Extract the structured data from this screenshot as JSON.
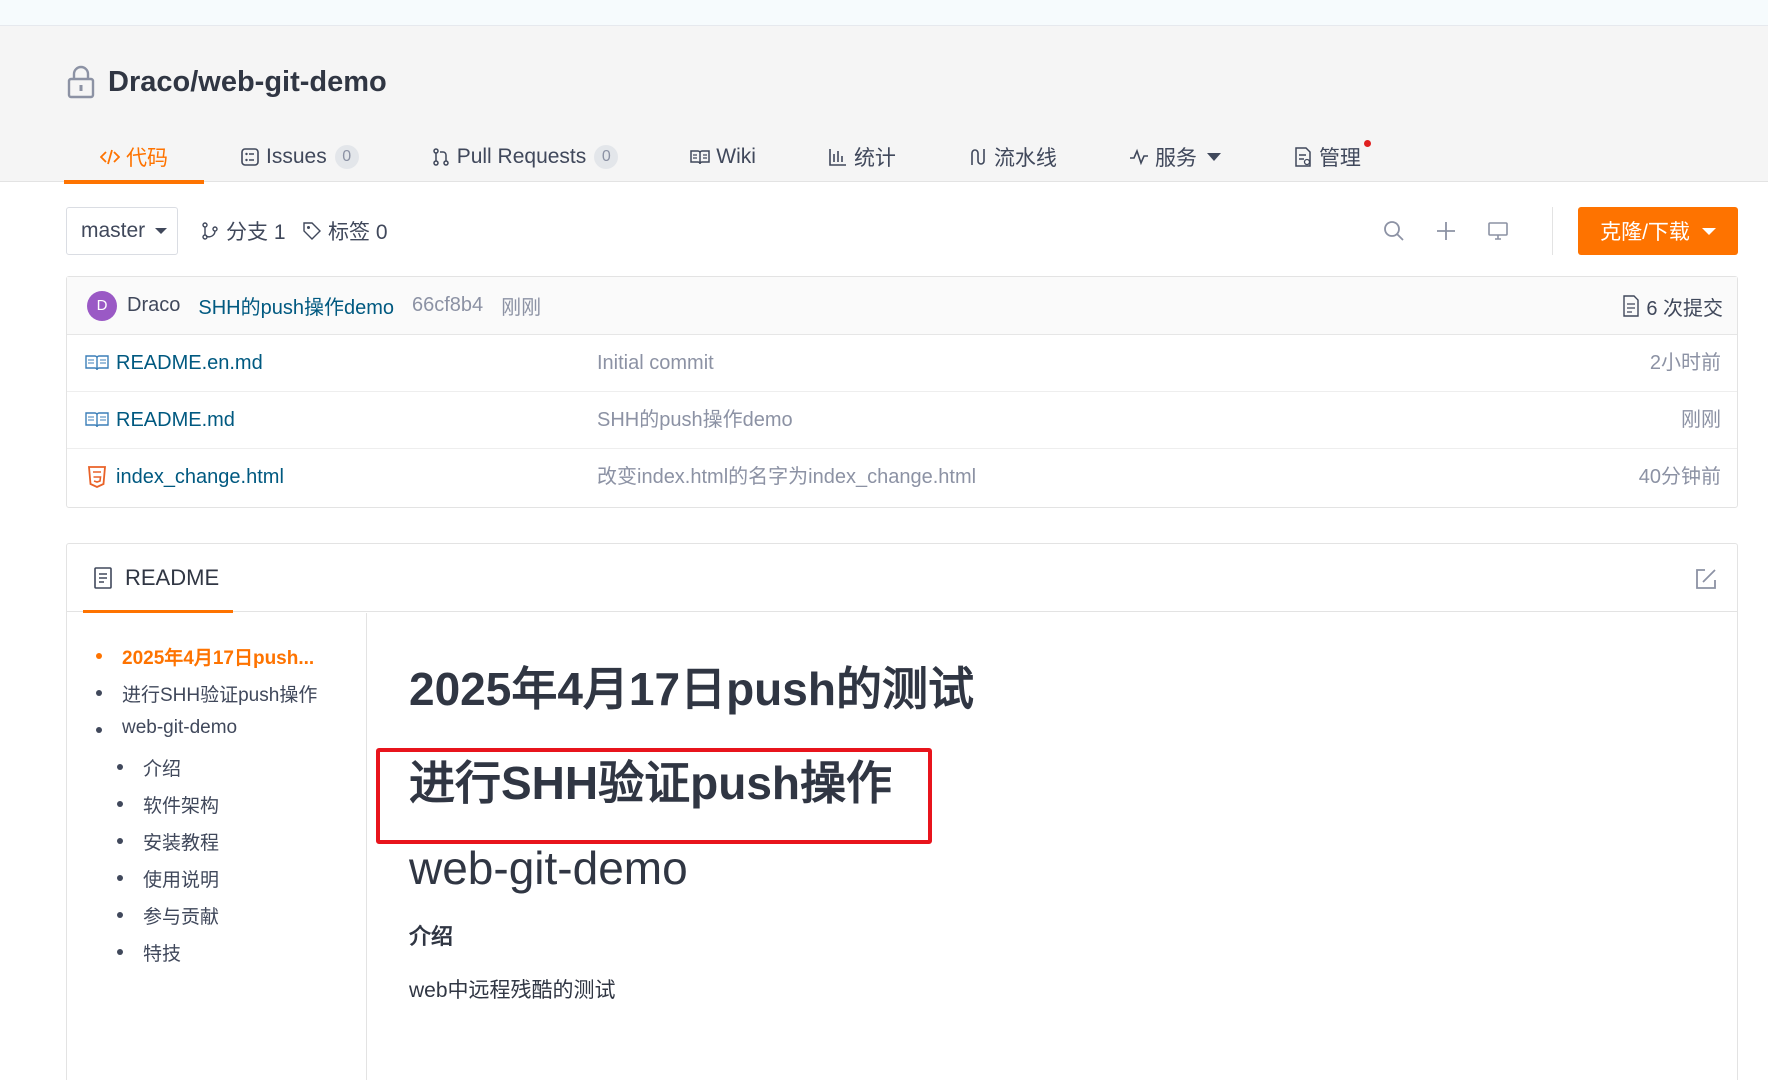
{
  "repo": {
    "full_name": "Draco/web-git-demo"
  },
  "tabs": [
    {
      "label": "代码",
      "icon": "code-icon",
      "active": true
    },
    {
      "label": "Issues",
      "count": "0",
      "icon": "issues-icon"
    },
    {
      "label": "Pull Requests",
      "count": "0",
      "icon": "pull-request-icon"
    },
    {
      "label": "Wiki",
      "icon": "wiki-book-icon"
    },
    {
      "label": "统计",
      "icon": "stats-chart-icon"
    },
    {
      "label": "流水线",
      "icon": "pipeline-icon"
    },
    {
      "label": "服务",
      "icon": "service-pulse-icon",
      "dropdown": true
    },
    {
      "label": "管理",
      "icon": "manage-doc-icon",
      "has_notification": true
    }
  ],
  "toolbar": {
    "branch": "master",
    "branches_label": "分支 1",
    "tags_label": "标签 0",
    "clone_label": "克隆/下载"
  },
  "latest_commit": {
    "avatar_letter": "D",
    "author": "Draco",
    "message": "SHH的push操作demo",
    "sha": "66cf8b4",
    "time": "刚刚",
    "commits_label": "6 次提交"
  },
  "files": [
    {
      "name": "README.en.md",
      "icon": "markdown-book-icon",
      "commit_message": "Initial commit",
      "time": "2小时前"
    },
    {
      "name": "README.md",
      "icon": "markdown-book-icon",
      "commit_message": "SHH的push操作demo",
      "time": "刚刚"
    },
    {
      "name": "index_change.html",
      "icon": "html5-icon",
      "commit_message": "改变index.html的名字为index_change.html",
      "time": "40分钟前"
    }
  ],
  "readme": {
    "tab_label": "README",
    "toc": [
      {
        "label": "2025年4月17日push...",
        "active": true,
        "level": 1
      },
      {
        "label": "进行SHH验证push操作",
        "level": 1
      },
      {
        "label": "web-git-demo",
        "level": 1
      },
      {
        "label": "介绍",
        "level": 2
      },
      {
        "label": "软件架构",
        "level": 2
      },
      {
        "label": "安装教程",
        "level": 2
      },
      {
        "label": "使用说明",
        "level": 2
      },
      {
        "label": "参与贡献",
        "level": 2
      },
      {
        "label": "特技",
        "level": 2
      }
    ],
    "headings": [
      "2025年4月17日push的测试",
      "进行SHH验证push操作",
      "web-git-demo"
    ],
    "section_title": "介绍",
    "section_text": "web中远程残酷的测试"
  },
  "colors": {
    "accent": "#fe7300",
    "link": "#005980",
    "highlight_border": "#e8141c"
  }
}
